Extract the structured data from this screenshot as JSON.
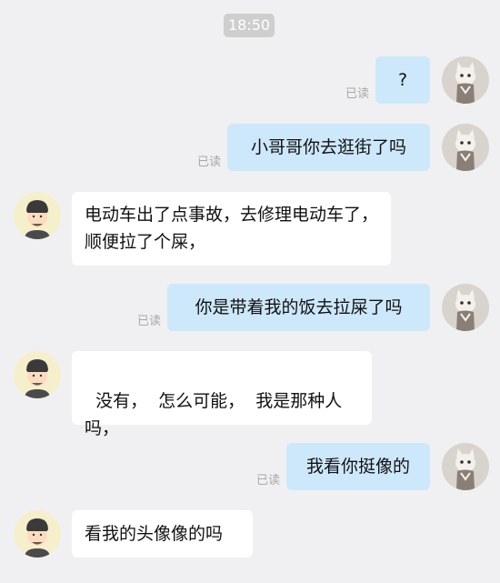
{
  "timestamp": "18:50",
  "read_status_label": "已读",
  "messages": [
    {
      "sender": "me",
      "text": "?",
      "read": "已读"
    },
    {
      "sender": "me",
      "text": "小哥哥你去逛街了吗",
      "read": "已读"
    },
    {
      "sender": "other",
      "text": "电动车出了点事故，去修理电动车了，顺便拉了个屎，"
    },
    {
      "sender": "me",
      "text": "你是带着我的饭去拉屎了吗",
      "read": "已读"
    },
    {
      "sender": "other",
      "text": "没有，  怎么可能，  我是那种人吗，"
    },
    {
      "sender": "me",
      "text": "我看你挺像的",
      "read": "已读"
    },
    {
      "sender": "other",
      "text": "看我的头像像的吗"
    }
  ],
  "icons": {
    "my_avatar": "cat-avatar-icon",
    "other_avatar": "cartoon-man-avatar-icon"
  },
  "colors": {
    "background": "#f0f0f2",
    "my_bubble": "#cde8fb",
    "other_bubble": "#ffffff",
    "timestamp_bg": "#cecece",
    "read_text": "#a8a8a8"
  }
}
